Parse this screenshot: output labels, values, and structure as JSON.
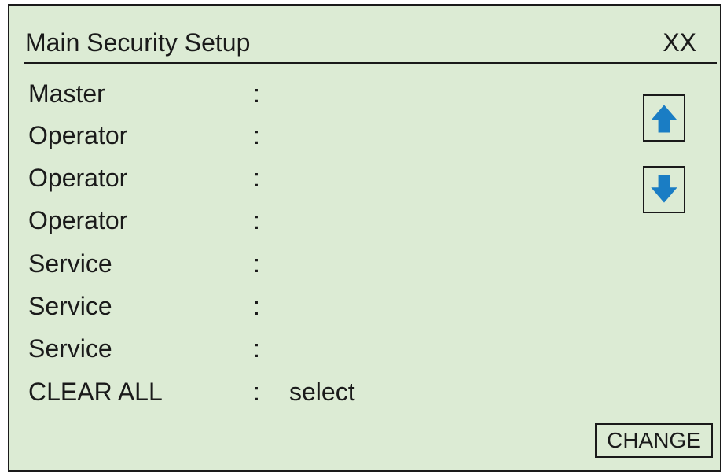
{
  "header": {
    "title": "Main Security Setup",
    "code": "XX"
  },
  "rows": [
    {
      "label": "Master",
      "colon": ":",
      "value": ""
    },
    {
      "label": "Operator",
      "colon": ":",
      "value": ""
    },
    {
      "label": "Operator",
      "colon": ":",
      "value": ""
    },
    {
      "label": "Operator",
      "colon": ":",
      "value": ""
    },
    {
      "label": "Service",
      "colon": ":",
      "value": ""
    },
    {
      "label": "Service",
      "colon": ":",
      "value": ""
    },
    {
      "label": "Service",
      "colon": ":",
      "value": ""
    },
    {
      "label": "CLEAR ALL",
      "colon": ":",
      "value": "select"
    }
  ],
  "controls": {
    "scroll_up_icon": "arrow-up-icon",
    "scroll_down_icon": "arrow-down-icon",
    "change_label": "CHANGE"
  },
  "colors": {
    "screen_background": "#dcebd4",
    "arrow": "#1a7dc4",
    "border": "#1a1a1a"
  }
}
